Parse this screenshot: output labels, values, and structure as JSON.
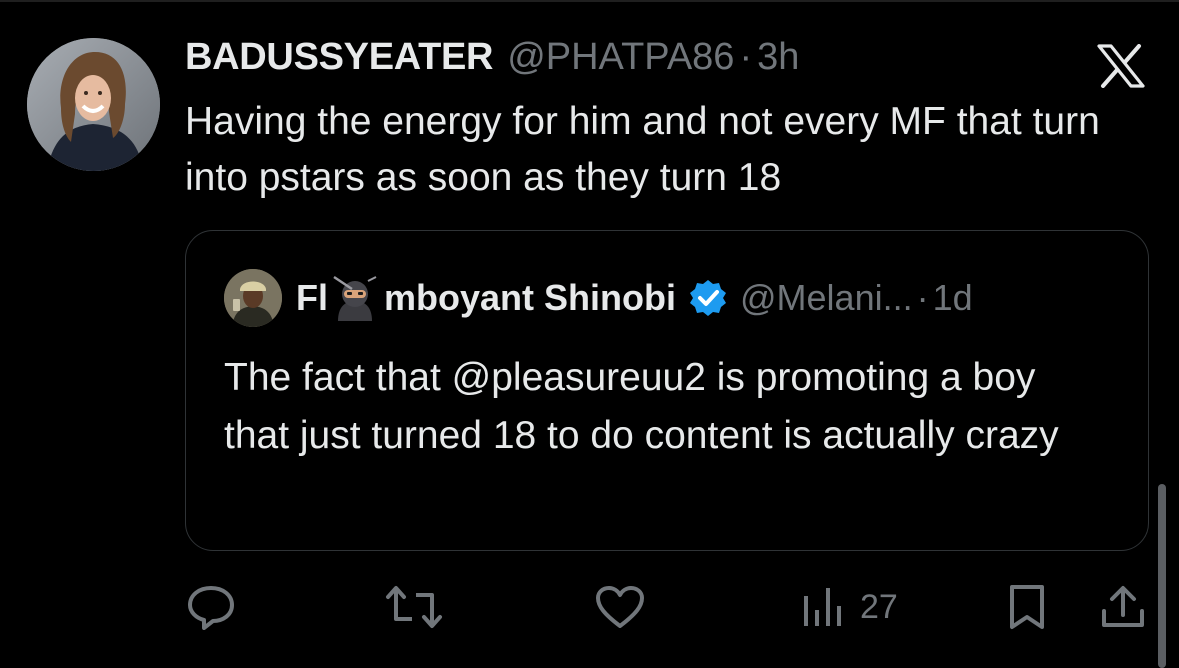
{
  "post": {
    "display_name": "BADUSSYEATER",
    "handle": "@PHATPA86",
    "separator": "·",
    "time": "3h",
    "text": "Having the energy for him and not every MF that turn into pstars as soon as they turn 18"
  },
  "quoted": {
    "name_part1": "Fl",
    "name_emoji": "ninja-emoji",
    "name_part2": "mboyant Shinobi",
    "verified": true,
    "handle": "@Melani...",
    "separator": "·",
    "time": "1d",
    "text": "The fact that @pleasureuu2 is promoting a boy that just turned 18 to do content is actually crazy"
  },
  "actions": {
    "reply_icon": "reply-icon",
    "repost_icon": "repost-icon",
    "like_icon": "like-icon",
    "views_icon": "views-icon",
    "views_count": "27",
    "bookmark_icon": "bookmark-icon",
    "share_icon": "share-icon"
  },
  "brand": {
    "logo": "x-logo-icon"
  },
  "colors": {
    "background": "#000000",
    "text_primary": "#e7e9ea",
    "text_secondary": "#71767b",
    "border": "#2f3336",
    "verified_blue": "#1d9bf0"
  }
}
